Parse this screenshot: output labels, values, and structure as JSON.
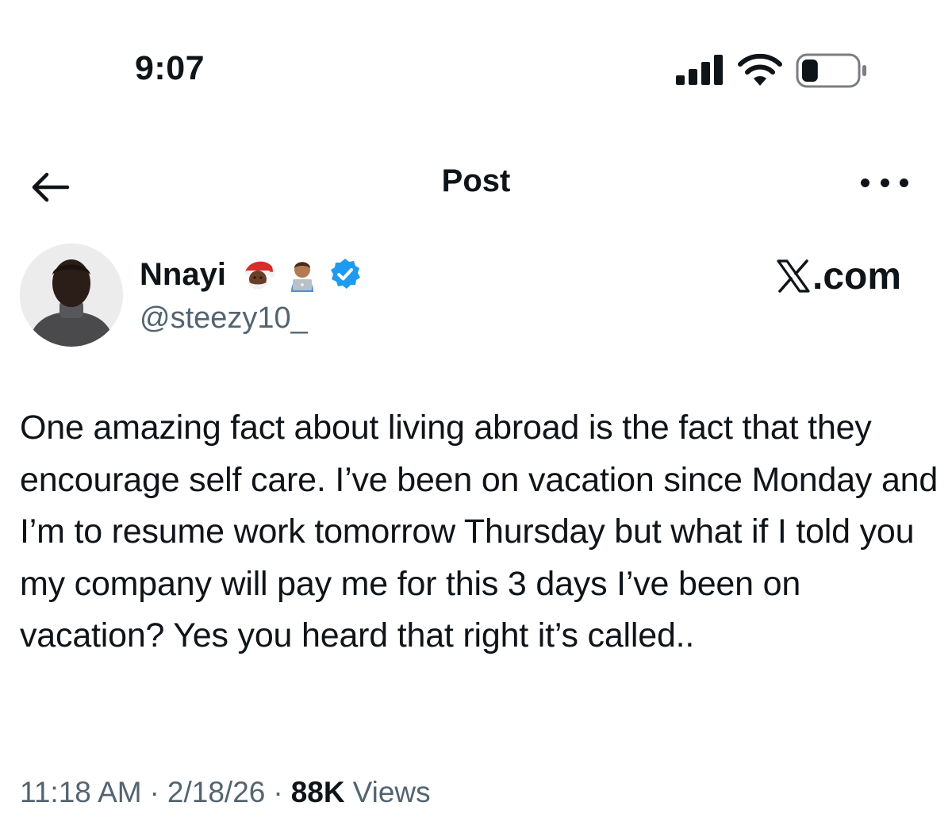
{
  "status_bar": {
    "time": "9:07",
    "signal_icon": "cellular-signal-icon",
    "wifi_icon": "wifi-icon",
    "battery_icon": "battery-icon",
    "battery_level": 0.3
  },
  "header": {
    "back_icon": "arrow-left-icon",
    "title": "Post",
    "more_icon": "more-horizontal-icon"
  },
  "author": {
    "name": "Nnayi",
    "emojis": [
      "santa-emoji",
      "technologist-emoji"
    ],
    "verified_icon": "verified-badge-icon",
    "handle": "@steezy10_"
  },
  "brand": {
    "logo_icon": "x-logo-icon",
    "text": ".com"
  },
  "post": {
    "text": "One amazing fact about living abroad is the fact that they encourage self care. I’ve been on vacation since Monday and I’m to resume work tomorrow Thursday but what if I told you my company will pay me for this 3 days I’ve been on vacation? Yes you heard that right it’s called.."
  },
  "meta": {
    "time": "11:18 AM",
    "separator": "·",
    "date": "2/18/26",
    "views_count": "88K",
    "views_label": "Views"
  },
  "colors": {
    "text_primary": "#0f1419",
    "text_secondary": "#536471",
    "verified_blue": "#1d9bf0",
    "background": "#ffffff"
  }
}
